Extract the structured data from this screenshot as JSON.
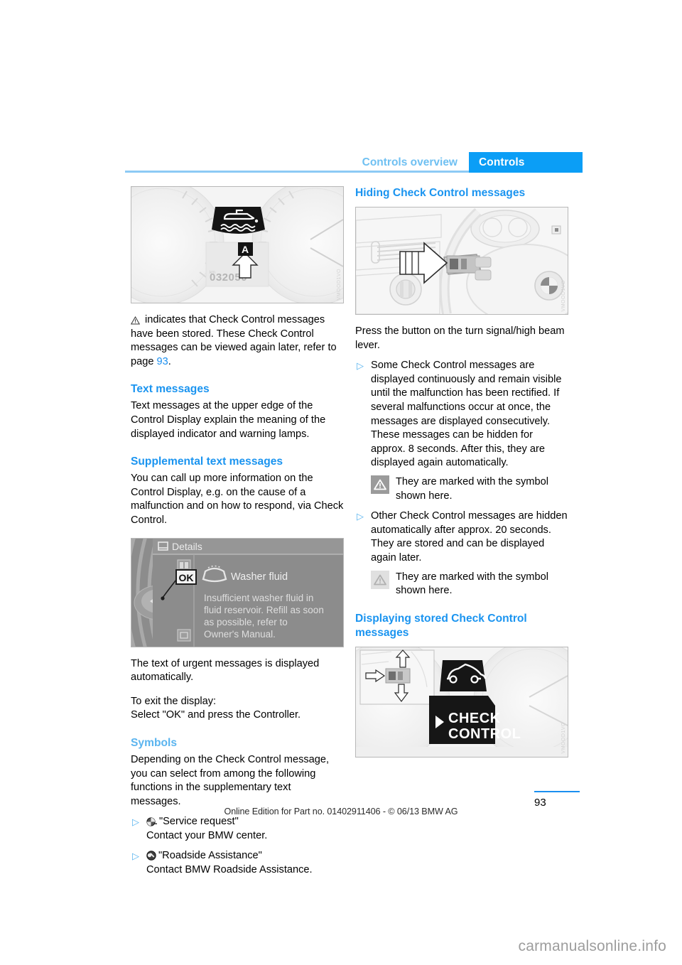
{
  "header": {
    "breadcrumb_secondary": "Controls overview",
    "tab_active": "Controls"
  },
  "left_column": {
    "figure_cluster": {
      "name": "instrument-cluster-oil-level",
      "odometer": "032050",
      "callout_label": "A",
      "watermark": "VMOOD1VO"
    },
    "intro_paragraph": {
      "icon": "warning-triangle-icon",
      "text_before_link": " indicates that Check Control messages have been stored. These Check Control messages can be viewed again later, refer to page ",
      "link": "93",
      "text_after_link": "."
    },
    "heading_text_messages": "Text messages",
    "para_text_messages": "Text messages at the upper edge of the Control Display explain the meaning of the displayed indicator and warning lamps.",
    "heading_supplemental": "Supplemental text messages",
    "para_supplemental": "You can call up more information on the Control Display, e.g. on the cause of a malfunction and on how to respond, via Check Control.",
    "figure_control_display": {
      "name": "control-display-details-washer-fluid",
      "titlebar": "Details",
      "ok_label": "OK",
      "item_title": "Washer fluid",
      "item_body": "Insufficient washer fluid in fluid reservoir. Refill as soon as possible, refer to Owner's Manual."
    },
    "para_urgent": "The text of urgent messages is displayed automatically.",
    "para_exit_line1": "To exit the display:",
    "para_exit_line2": "Select \"OK\" and press the Controller.",
    "heading_symbols": "Symbols",
    "para_symbols": "Depending on the Check Control message, you can select from among the following functions in the supplementary text messages.",
    "bullets": [
      {
        "marker": "▷",
        "icon": "bmw-service-icon",
        "line1": "\"Service request\"",
        "line2": "Contact your BMW center."
      },
      {
        "marker": "▷",
        "icon": "roadside-assistance-icon",
        "line1": "\"Roadside Assistance\"",
        "line2": "Contact BMW Roadside Assistance."
      }
    ]
  },
  "right_column": {
    "heading_hiding": "Hiding Check Control messages",
    "figure_lever": {
      "name": "turn-signal-high-beam-lever",
      "watermark": "VMOOD1VO"
    },
    "para_press_button": "Press the button on the turn signal/high beam lever.",
    "bullets": [
      {
        "marker": "▷",
        "text": "Some Check Control messages are displayed continuously and remain visible until the malfunction has been rectified. If several malfunctions occur at once, the messages are displayed consecutively.\nThese messages can be hidden for approx. 8 seconds. After this, they are displayed again automatically."
      },
      {
        "marker": "▷",
        "text": "Other Check Control messages are hidden automatically after approx. 20 seconds. They are stored and can be displayed again later."
      }
    ],
    "symbol_notes": [
      {
        "style": "dark",
        "icon": "warning-triangle-icon",
        "text": "They are marked with the symbol shown here."
      },
      {
        "style": "light",
        "icon": "warning-triangle-icon",
        "text": "They are marked with the symbol shown here."
      }
    ],
    "heading_displaying": "Displaying stored Check Control messages",
    "figure_check_control": {
      "name": "check-control-button-cluster",
      "car_icon": "car-silhouette-icon",
      "button_line1": "CHECK",
      "button_line2": "CONTROL",
      "watermark": "VMOOD1VO"
    }
  },
  "footer": {
    "note": "Online Edition for Part no. 01402911406 - © 06/13 BMW AG",
    "page_number": "93"
  },
  "site_watermark": "carmanualsonline.info",
  "colors": {
    "accent_blue": "#1a8ff0",
    "tab_blue": "#0b9ef6",
    "light_blue": "#8dcaf5",
    "heading_light": "#5ab4ef"
  }
}
